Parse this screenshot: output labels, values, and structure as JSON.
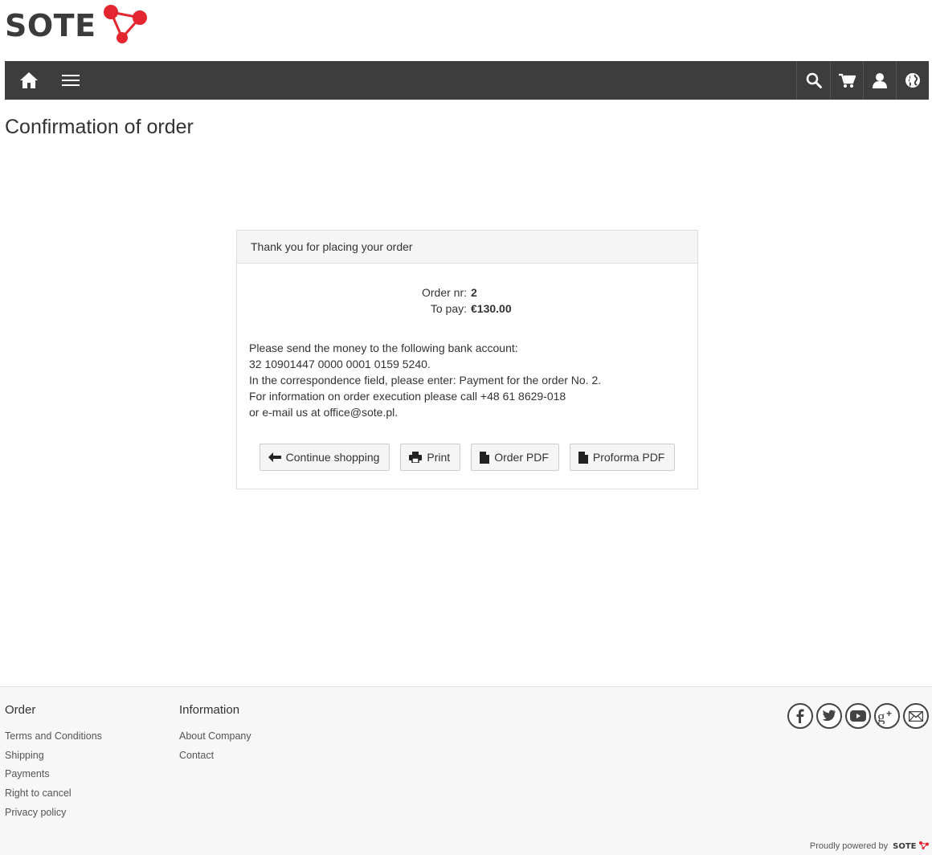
{
  "logo": {
    "text": "SOTE"
  },
  "nav": {
    "home_icon": "home-icon",
    "menu_icon": "hamburger-icon",
    "right_icons": [
      "search-icon",
      "cart-icon",
      "user-icon",
      "globe-icon"
    ]
  },
  "page": {
    "title": "Confirmation of order"
  },
  "panel": {
    "heading": "Thank you for placing your order",
    "order_label": "Order nr:",
    "order_value": "2",
    "pay_label": "To pay:",
    "pay_value": "€130.00",
    "lines": [
      "Please send the money to the following bank account:",
      "32 10901447 0000 0001 0159 5240.",
      "In the correspondence field, please enter: Payment for the order No. 2.",
      "For information on order execution please call +48 61 8629-018",
      "or e-mail us at office@sote.pl."
    ],
    "buttons": {
      "continue": "Continue shopping",
      "print": "Print",
      "order_pdf": "Order PDF",
      "proforma_pdf": "Proforma PDF"
    }
  },
  "footer": {
    "order": {
      "heading": "Order",
      "links": [
        "Terms and Conditions",
        "Shipping",
        "Payments",
        "Right to cancel",
        "Privacy policy"
      ]
    },
    "information": {
      "heading": "Information",
      "links": [
        "About Company",
        "Contact"
      ]
    },
    "social_icons": [
      "facebook-icon",
      "twitter-icon",
      "youtube-icon",
      "google-plus-icon",
      "email-icon"
    ],
    "powered_by": "Proudly powered by",
    "powered_logo": "SOTE"
  },
  "colors": {
    "navbar": "#3d3d3d",
    "brand_red": "#e3262f",
    "panel_heading_bg": "#f5f5f5",
    "footer_bg": "#f7f7f7"
  }
}
